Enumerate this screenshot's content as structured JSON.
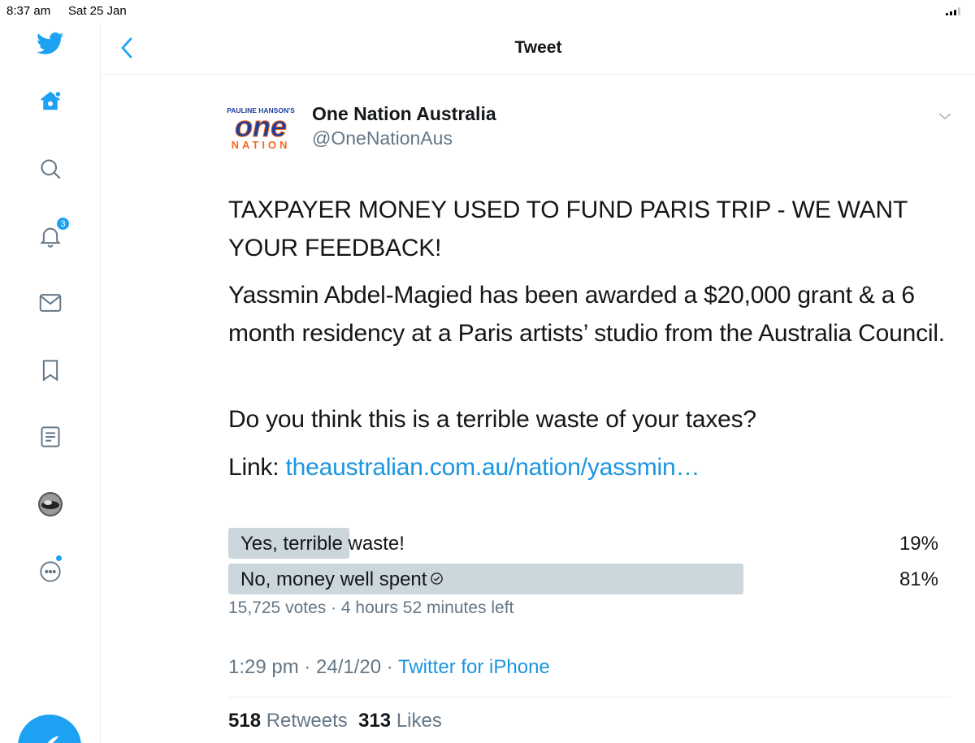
{
  "status_bar": {
    "time": "8:37 am",
    "date": "Sat 25 Jan"
  },
  "sidebar": {
    "items": [
      {
        "icon": "twitter-logo-icon"
      },
      {
        "icon": "home-icon"
      },
      {
        "icon": "search-icon"
      },
      {
        "icon": "notifications-icon",
        "badge": "3"
      },
      {
        "icon": "messages-icon"
      },
      {
        "icon": "bookmarks-icon"
      },
      {
        "icon": "lists-icon"
      },
      {
        "icon": "profile-avatar"
      },
      {
        "icon": "more-icon"
      }
    ],
    "compose_icon": "compose-tweet-icon"
  },
  "header": {
    "title": "Tweet"
  },
  "tweet": {
    "author_name": "One Nation Australia",
    "author_handle": "@OneNationAus",
    "logo": {
      "top_text": "PAULINE HANSON'S",
      "main_text": "one",
      "bottom_text": "NATION"
    },
    "paragraphs": [
      "TAXPAYER MONEY USED TO FUND PARIS TRIP - WE WANT YOUR FEEDBACK!",
      "Yassmin Abdel-Magied has been awarded a $20,000 grant & a 6 month residency at a Paris artists’ studio from the Australia Council.",
      "Do you think this is a terrible waste of your taxes?"
    ],
    "link_prefix": "Link:",
    "link_text": "theaustralian.com.au/nation/yassmin…",
    "poll": {
      "options": [
        {
          "label": "Yes, terrible waste!",
          "percent_text": "19%",
          "percent": 19,
          "winner": false
        },
        {
          "label": "No, money well spent",
          "percent_text": "81%",
          "percent": 81,
          "winner": true
        }
      ],
      "meta": "15,725 votes · 4 hours 52 minutes left"
    },
    "timestamp": "1:29 pm · 24/1/20 · ",
    "source": "Twitter for iPhone",
    "retweets_count": "518",
    "retweets_label": "Retweets",
    "likes_count": "313",
    "likes_label": "Likes"
  },
  "colors": {
    "accent": "#1da1f2",
    "link": "#1b95e0",
    "secondary_text": "#657786",
    "poll_bar_loser": "#ccd6dd",
    "poll_bar_winner": "#ccd6dd",
    "logo_blue": "#1c3f9c",
    "logo_orange": "#f26a21"
  }
}
